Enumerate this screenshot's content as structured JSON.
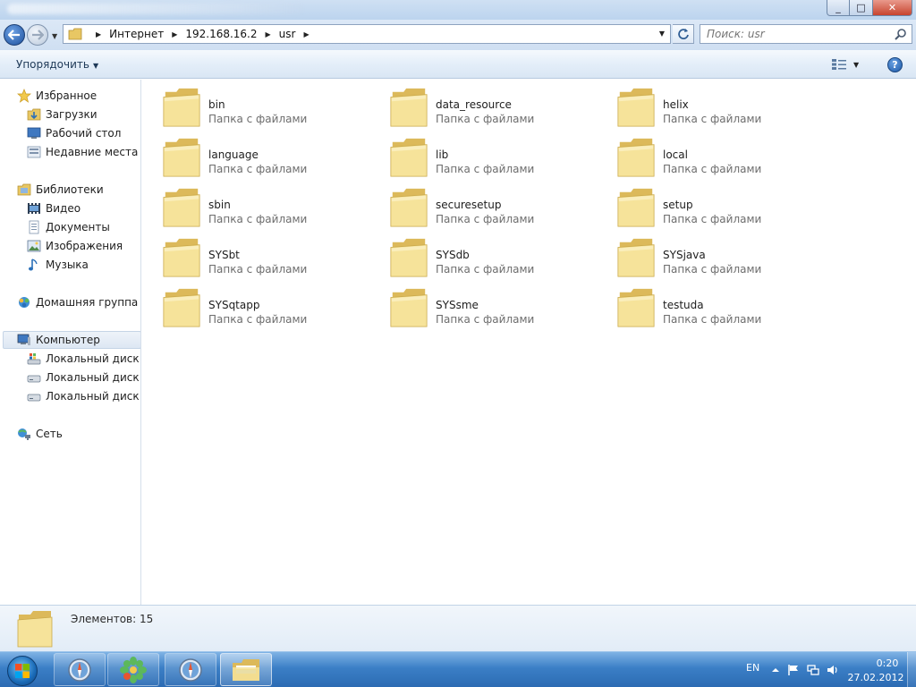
{
  "window": {
    "minimize_glyph": "_",
    "maximize_glyph": "□",
    "close_glyph": "✕"
  },
  "address": {
    "breadcrumbs": [
      "Интернет",
      "192.168.16.2",
      "usr"
    ],
    "search_placeholder": "Поиск: usr"
  },
  "toolbar": {
    "organize_label": "Упорядочить",
    "help_glyph": "?"
  },
  "sidebar": {
    "favorites": {
      "label": "Избранное",
      "items": [
        "Загрузки",
        "Рабочий стол",
        "Недавние места"
      ]
    },
    "libraries": {
      "label": "Библиотеки",
      "items": [
        "Видео",
        "Документы",
        "Изображения",
        "Музыка"
      ]
    },
    "homegroup": {
      "label": "Домашняя группа"
    },
    "computer": {
      "label": "Компьютер",
      "items": [
        "Локальный диск (C:)",
        "Локальный диск (D:)",
        "Локальный диск (E:)"
      ]
    },
    "network": {
      "label": "Сеть"
    }
  },
  "folders": [
    {
      "name": "bin",
      "type": "Папка с файлами"
    },
    {
      "name": "data_resource",
      "type": "Папка с файлами"
    },
    {
      "name": "helix",
      "type": "Папка с файлами"
    },
    {
      "name": "language",
      "type": "Папка с файлами"
    },
    {
      "name": "lib",
      "type": "Папка с файлами"
    },
    {
      "name": "local",
      "type": "Папка с файлами"
    },
    {
      "name": "sbin",
      "type": "Папка с файлами"
    },
    {
      "name": "securesetup",
      "type": "Папка с файлами"
    },
    {
      "name": "setup",
      "type": "Папка с файлами"
    },
    {
      "name": "SYSbt",
      "type": "Папка с файлами"
    },
    {
      "name": "SYSdb",
      "type": "Папка с файлами"
    },
    {
      "name": "SYSjava",
      "type": "Папка с файлами"
    },
    {
      "name": "SYSqtapp",
      "type": "Папка с файлами"
    },
    {
      "name": "SYSsme",
      "type": "Папка с файлами"
    },
    {
      "name": "testuda",
      "type": "Папка с файлами"
    }
  ],
  "status": {
    "item_count": "Элементов: 15"
  },
  "taskbar": {
    "language": "EN",
    "time": "0:20",
    "date": "27.02.2012",
    "apps": [
      "safari-icon",
      "icq-icon",
      "safari-icon",
      "explorer-icon"
    ]
  },
  "colors": {
    "folder_light": "#f6e39a",
    "folder_dark": "#dcb95a",
    "taskbar": "#2c6bb3",
    "selection": "#dde7f3"
  }
}
